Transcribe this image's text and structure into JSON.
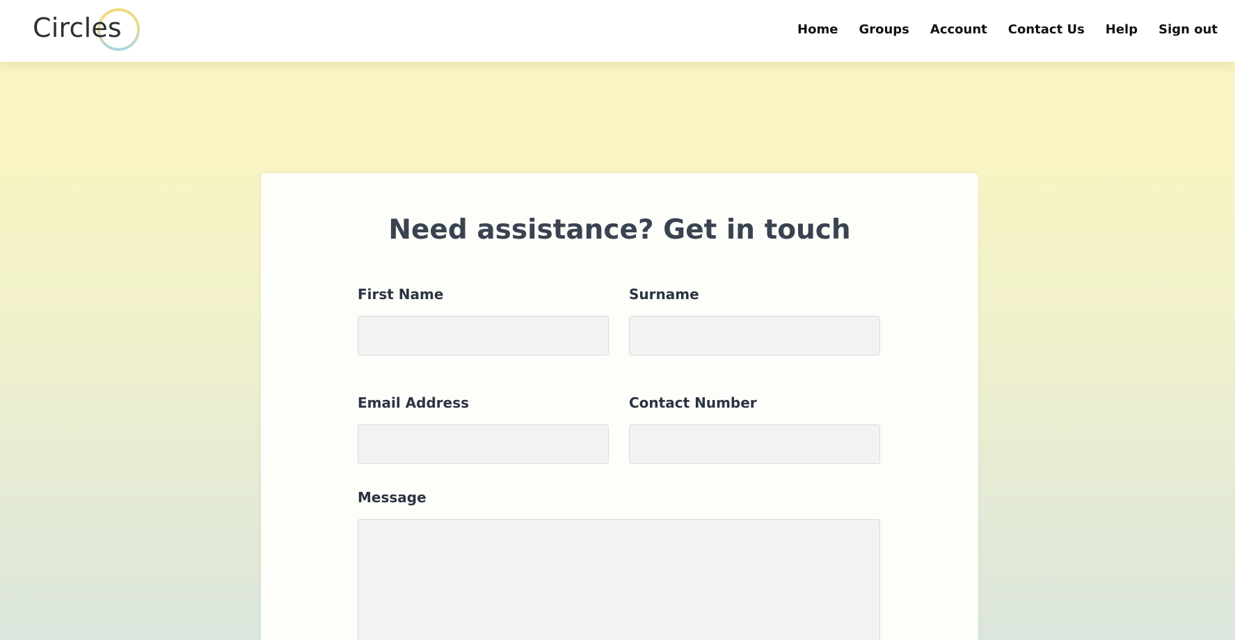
{
  "header": {
    "logo_text": "Circles",
    "nav": [
      {
        "label": "Home"
      },
      {
        "label": "Groups"
      },
      {
        "label": "Account"
      },
      {
        "label": "Contact Us"
      },
      {
        "label": "Help"
      },
      {
        "label": "Sign out"
      }
    ]
  },
  "form": {
    "title": "Need assistance? Get in touch",
    "first_name": {
      "label": "First Name",
      "value": "",
      "placeholder": ""
    },
    "surname": {
      "label": "Surname",
      "value": "",
      "placeholder": ""
    },
    "email": {
      "label": "Email Address",
      "value": "",
      "placeholder": ""
    },
    "contact_number": {
      "label": "Contact Number",
      "value": "",
      "placeholder": ""
    },
    "message": {
      "label": "Message",
      "value": "",
      "placeholder": ""
    }
  },
  "colors": {
    "logo_ring_yellow": "#f3d77a",
    "logo_ring_blue": "#a9d6df",
    "title_text": "#3a4350",
    "input_background": "#f1f3f3"
  }
}
